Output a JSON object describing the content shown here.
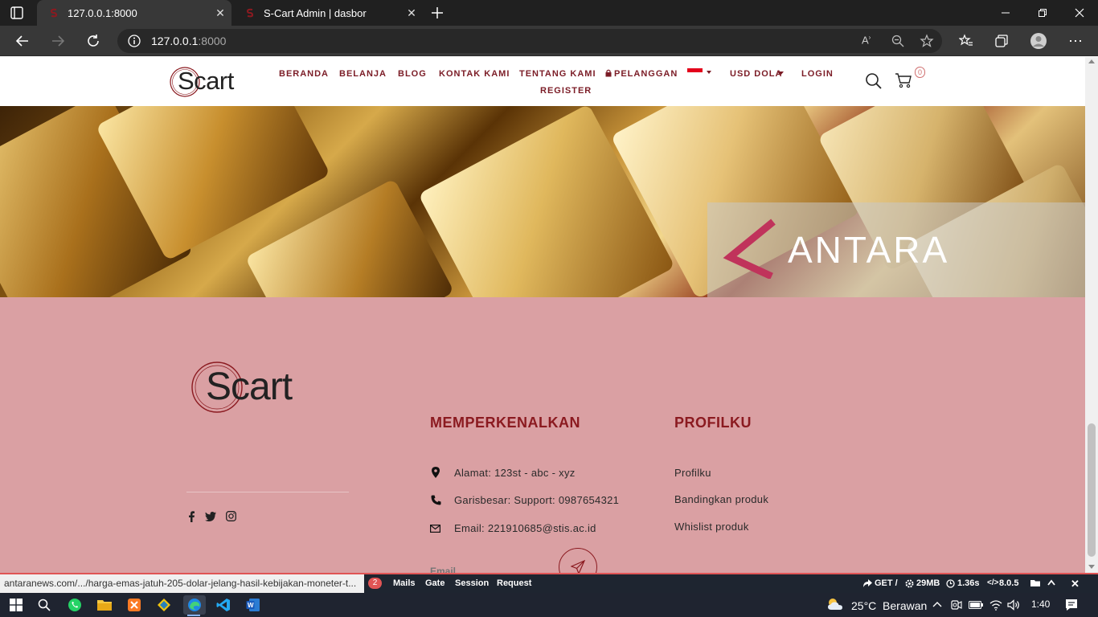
{
  "browser": {
    "tabs": [
      {
        "title": "127.0.0.1:8000",
        "active": true
      },
      {
        "title": "S-Cart Admin | dasbor",
        "active": false
      }
    ],
    "address": {
      "host": "127.0.0.1",
      "port": ":8000"
    }
  },
  "site": {
    "logo_text": "Scart",
    "menu": [
      "BERANDA",
      "BELANJA",
      "BLOG",
      "KONTAK KAMI",
      "TENTANG KAMI",
      "PELANGGAN",
      "USD DOLA",
      "LOGIN",
      "REGISTER"
    ],
    "cart_count": "0",
    "hero_watermark": "ANTARA",
    "footer": {
      "logo_text": "Scart",
      "about_title": "MEMPERKENALKAN",
      "address": "Alamat: 123st - abc - xyz",
      "phone": "Garisbesar: Support: 0987654321",
      "email": "Email: 221910685@stis.ac.id",
      "email_placeholder": "Email",
      "profile_title": "PROFILKU",
      "profile_links": [
        "Profilku",
        "Bandingkan produk",
        "Whislist produk"
      ]
    }
  },
  "status_url": "antaranews.com/.../harga-emas-jatuh-205-dolar-jelang-hasil-kebijakan-moneter-t...",
  "debugbar": {
    "badge": "2",
    "tabs": [
      "Mails",
      "Gate",
      "Session",
      "Request"
    ],
    "method": "GET /",
    "memory": "29MB",
    "time": "1.36s",
    "php": "8.0.5"
  },
  "taskbar": {
    "weather": "25°C  Berawan",
    "clock": "1:40"
  },
  "colors": {
    "brand": "#8b1a20",
    "footer_bg": "#daa0a3",
    "back_to_top": "#d05a5a"
  }
}
